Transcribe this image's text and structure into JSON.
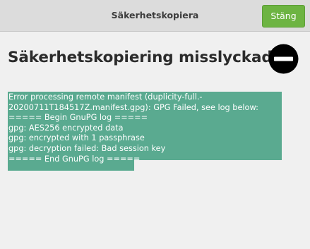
{
  "window": {
    "title": "Säkerhetskopiera",
    "close_label": "Stäng"
  },
  "main": {
    "heading": "Säkerhetskopiering misslyckades",
    "status_icon": "no-entry-icon",
    "log_lines": [
      "Error processing remote manifest (duplicity-full.-",
      "20200711T184517Z.manifest.gpg): GPG Failed, see log below:",
      "===== Begin GnuPG log =====",
      "gpg: AES256 encrypted data",
      "gpg: encrypted with 1 passphrase",
      "gpg: decryption failed: Bad session key",
      "===== End GnuPG log ====="
    ]
  },
  "colors": {
    "accent": "#6db442",
    "selection": "#5aaa90",
    "background": "#f0f0f0",
    "titlebar": "#dcdcdc"
  }
}
